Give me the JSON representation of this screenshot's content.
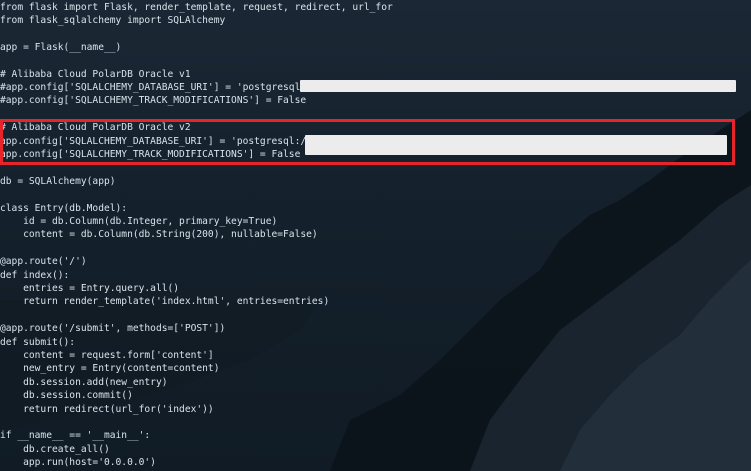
{
  "editor": {
    "colors": {
      "text": "#d9e3ec",
      "background": "#14202b",
      "highlight_box": "#e8242b",
      "redaction": "#ececec"
    },
    "code_lines": [
      "from flask import Flask, render_template, request, redirect, url_for",
      "from flask_sqlalchemy import SQLAlchemy",
      "",
      "app = Flask(__name__)",
      "",
      "# Alibaba Cloud PolarDB Oracle v1",
      "#app.config['SQLALCHEMY_DATABASE_URI'] = 'postgresql://",
      "#app.config['SQLALCHEMY_TRACK_MODIFICATIONS'] = False",
      "",
      "# Alibaba Cloud PolarDB Oracle v2",
      "app.config['SQLALCHEMY_DATABASE_URI'] = 'postgresql://",
      "app.config['SQLALCHEMY_TRACK_MODIFICATIONS'] = False",
      "",
      "db = SQLAlchemy(app)",
      "",
      "class Entry(db.Model):",
      "    id = db.Column(db.Integer, primary_key=True)",
      "    content = db.Column(db.String(200), nullable=False)",
      "",
      "@app.route('/')",
      "def index():",
      "    entries = Entry.query.all()",
      "    return render_template('index.html', entries=entries)",
      "",
      "@app.route('/submit', methods=['POST'])",
      "def submit():",
      "    content = request.form['content']",
      "    new_entry = Entry(content=content)",
      "    db.session.add(new_entry)",
      "    db.session.commit()",
      "    return redirect(url_for('index'))",
      "",
      "if __name__ == '__main__':",
      "    db.create_all()",
      "    app.run(host='0.0.0.0')"
    ]
  }
}
